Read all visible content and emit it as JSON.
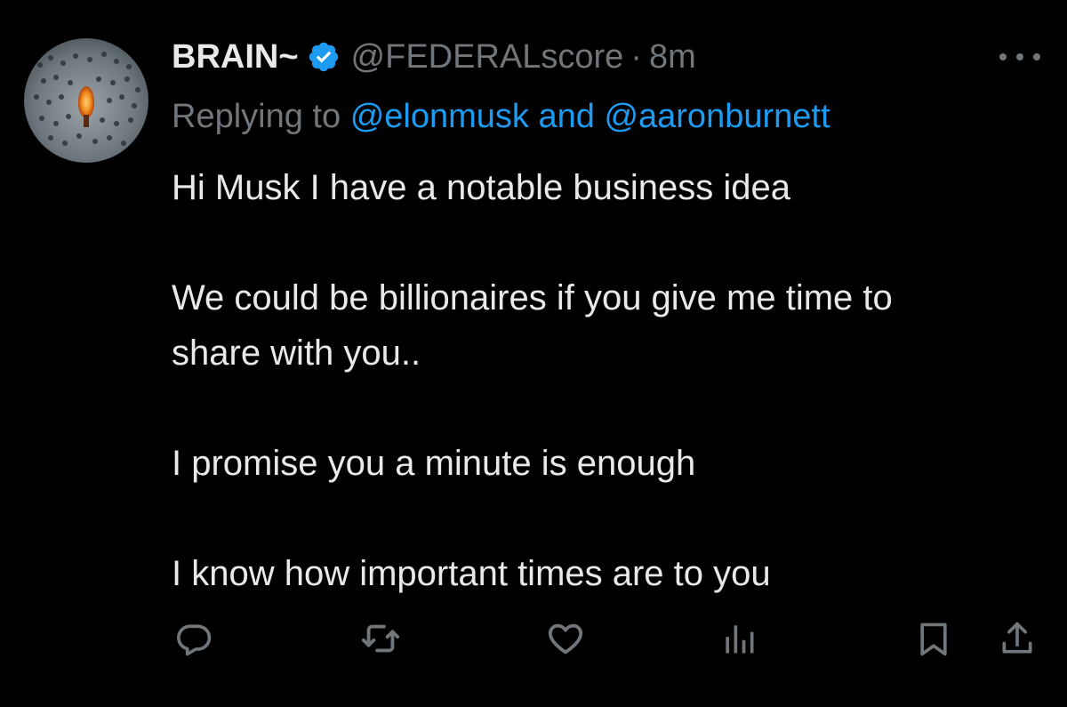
{
  "tweet": {
    "author": {
      "display_name": "BRAIN~",
      "handle": "@FEDERALscore",
      "separator": "·",
      "time": "8m",
      "verified": true
    },
    "reply": {
      "prefix": "Replying to",
      "user1": "@elonmusk",
      "conjunction": "and",
      "user2": "@aaronburnett"
    },
    "body": {
      "line1": "Hi Musk I have a notable business idea",
      "line2": "We could be billionaires if you give me time to",
      "line3": "share with you..",
      "line4": "I promise you a minute is enough",
      "line5": "I know how important times are to you"
    }
  },
  "icons": {
    "verified": "verified-badge-icon",
    "more": "more-dots-icon",
    "reply": "reply-bubble-icon",
    "retweet": "retweet-icon",
    "like": "heart-icon",
    "views": "views-bars-icon",
    "bookmark": "bookmark-icon",
    "share": "share-icon"
  },
  "colors": {
    "background": "#000000",
    "text": "#e7e9ea",
    "muted": "#71767b",
    "link": "#1d9bf0",
    "verified": "#1d9bf0"
  }
}
